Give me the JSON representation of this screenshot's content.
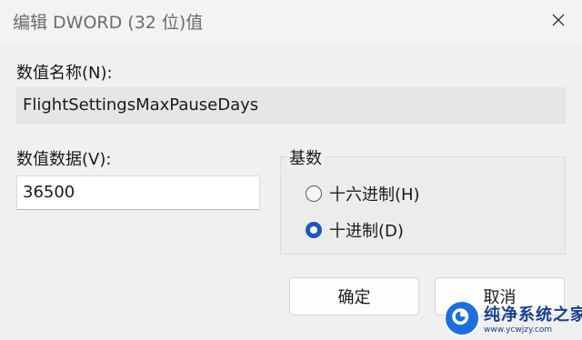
{
  "window": {
    "title": "编辑 DWORD (32 位)值",
    "close_icon": "close-icon"
  },
  "value_name": {
    "label": "数值名称(N):",
    "value": "FlightSettingsMaxPauseDays"
  },
  "value_data": {
    "label": "数值数据(V):",
    "value": "36500"
  },
  "base": {
    "title": "基数",
    "options": [
      {
        "label": "十六进制(H)",
        "checked": false
      },
      {
        "label": "十进制(D)",
        "checked": true
      }
    ]
  },
  "buttons": {
    "ok_label": "确定",
    "cancel_label": "取消"
  },
  "watermark": {
    "title": "纯净系统之家",
    "url": "www.ycwjzy.com",
    "brand_color": "#1e6fd9"
  },
  "colors": {
    "accent": "#1c5ab4"
  }
}
